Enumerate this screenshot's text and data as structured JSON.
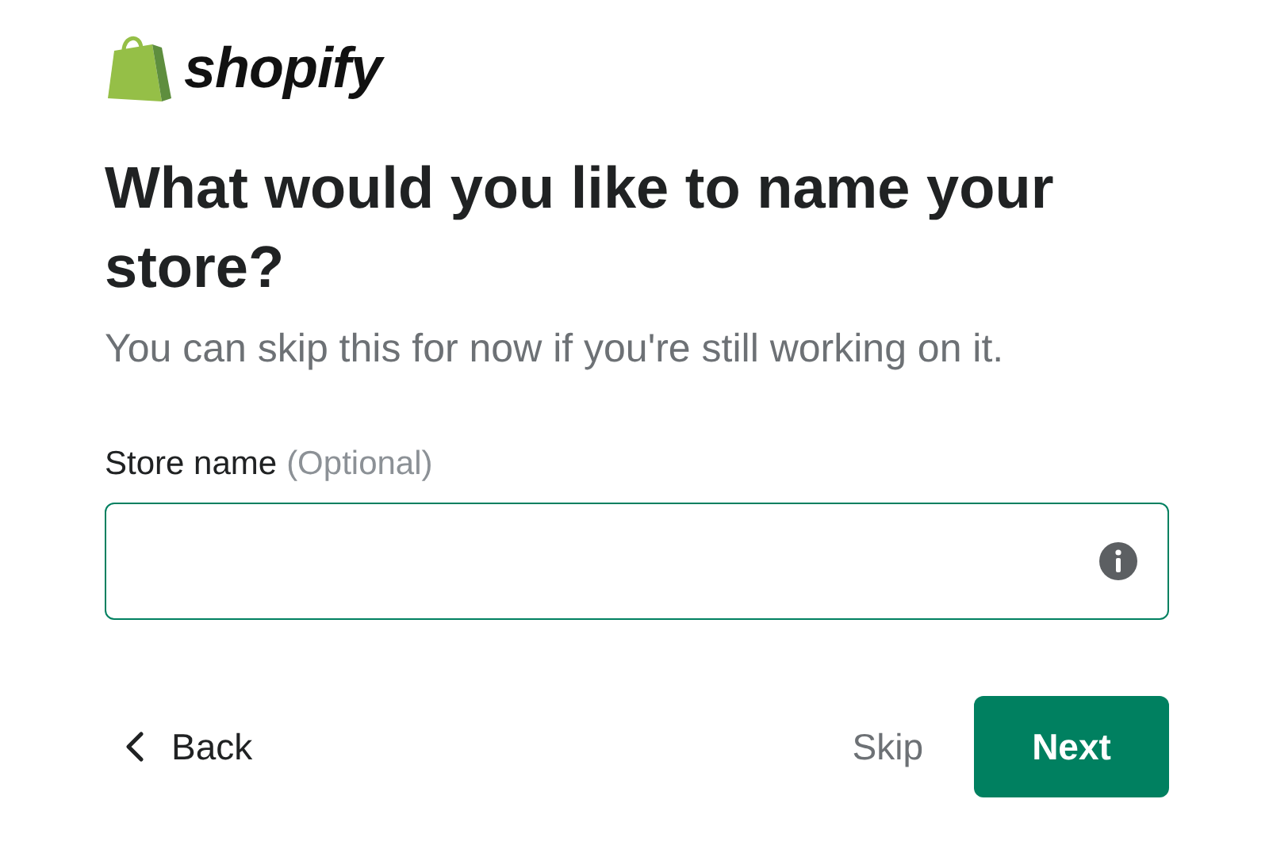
{
  "brand": {
    "name": "shopify"
  },
  "heading": "What would you like to name your store?",
  "subtitle": "You can skip this for now if you're still working on it.",
  "field": {
    "label": "Store name",
    "hint": "(Optional)",
    "focused": true
  },
  "buttons": [
    {
      "kind": "back",
      "label": "Back"
    },
    {
      "kind": "text",
      "label": "Skip"
    },
    {
      "kind": "primary",
      "label": "Next"
    }
  ]
}
